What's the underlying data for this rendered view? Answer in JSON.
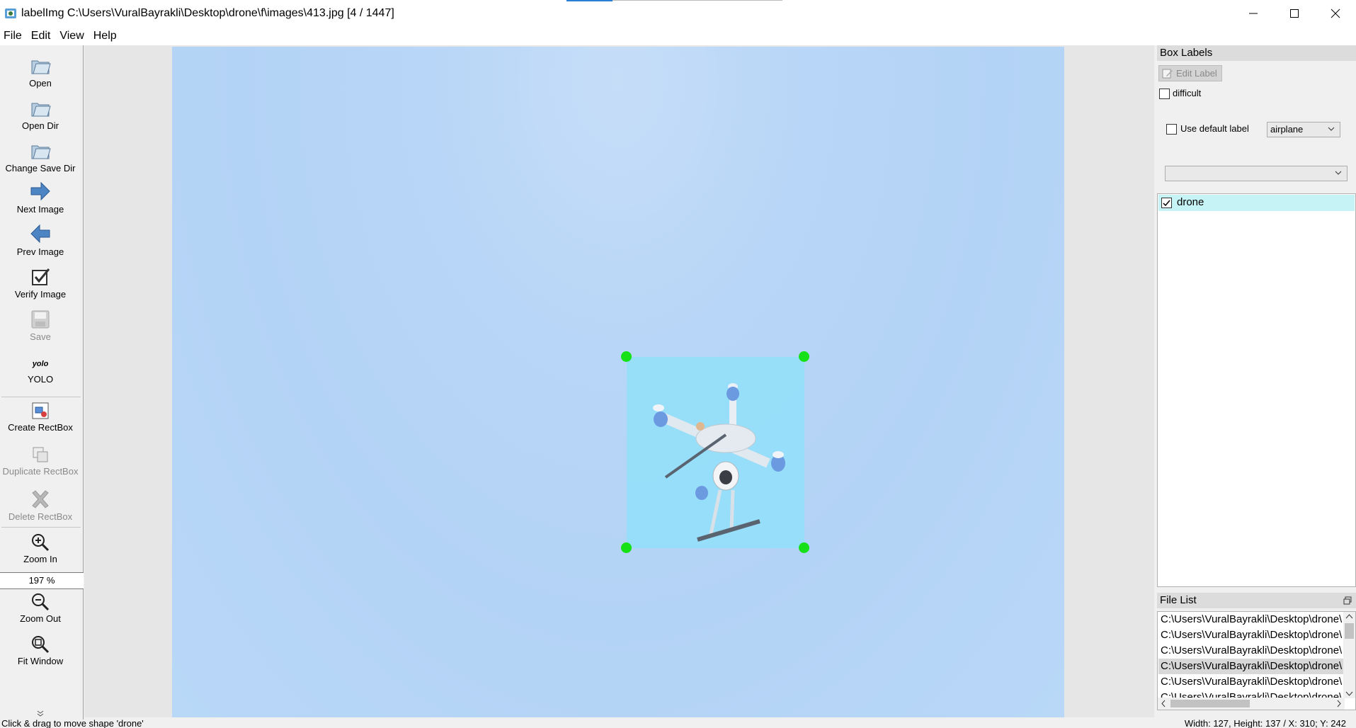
{
  "window": {
    "title": "labelImg C:\\Users\\VuralBayrakli\\Desktop\\drone\\f\\images\\413.jpg [4 / 1447]"
  },
  "menu": [
    "File",
    "Edit",
    "View",
    "Help"
  ],
  "toolbar": {
    "open": "Open",
    "open_dir": "Open Dir",
    "change_save_dir": "Change Save Dir",
    "next_image": "Next Image",
    "prev_image": "Prev Image",
    "verify_image": "Verify Image",
    "save": "Save",
    "yolo_icon_text": "yolo",
    "yolo": "YOLO",
    "create_rectbox": "Create RectBox",
    "duplicate_rectbox": "Duplicate RectBox",
    "delete_rectbox": "Delete RectBox",
    "zoom_in": "Zoom In",
    "zoom_value": "197 %",
    "zoom_out": "Zoom Out",
    "fit_window": "Fit Window"
  },
  "box_labels": {
    "title": "Box Labels",
    "edit_label": "Edit Label",
    "difficult": "difficult",
    "use_default_label": "Use default label",
    "default_label_value": "airplane",
    "filter_value": "",
    "labels": [
      {
        "text": "drone",
        "checked": true
      }
    ]
  },
  "file_list": {
    "title": "File List",
    "selected_index": 3,
    "items": [
      "C:\\Users\\VuralBayrakli\\Desktop\\drone\\",
      "C:\\Users\\VuralBayrakli\\Desktop\\drone\\",
      "C:\\Users\\VuralBayrakli\\Desktop\\drone\\",
      "C:\\Users\\VuralBayrakli\\Desktop\\drone\\",
      "C:\\Users\\VuralBayrakli\\Desktop\\drone\\",
      "C:\\Users\\VuralBayrakli\\Desktop\\drone\\"
    ]
  },
  "status": {
    "message": "Click & drag to move shape 'drone'",
    "coords": "Width: 127, Height: 137 / X: 310; Y: 242"
  },
  "colors": {
    "handle": "#16e016",
    "box_fill": "#8ce2fa",
    "selected_label": "#c6f3f6"
  }
}
